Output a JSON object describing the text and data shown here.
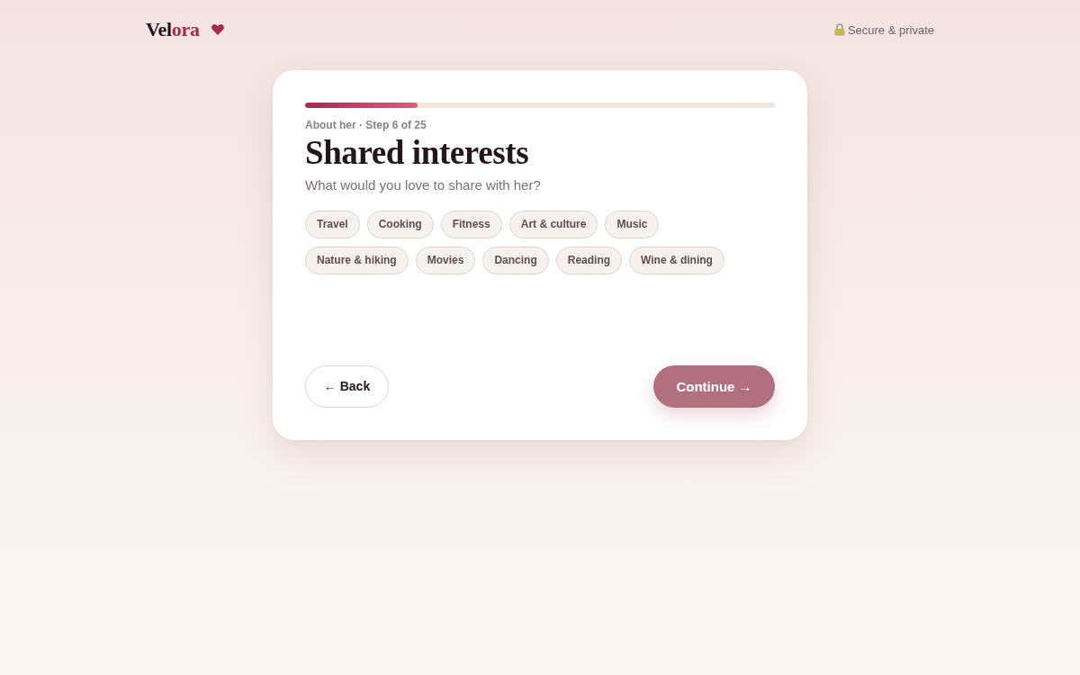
{
  "header": {
    "logo": [
      {
        "text": "Vel",
        "kind": "plain"
      },
      {
        "text": "ora",
        "kind": "accent"
      }
    ],
    "security_note": "Secure & private"
  },
  "card": {
    "progress": {
      "level": 0.24
    },
    "step_label": "About her · Step 6 of 25",
    "title": "Shared interests",
    "subtitle": "What would you love to share with her?",
    "interests": [
      {
        "label": "Travel",
        "selected": false
      },
      {
        "label": "Cooking",
        "selected": false
      },
      {
        "label": "Fitness",
        "selected": false
      },
      {
        "label": "Art & culture",
        "selected": false
      },
      {
        "label": "Music",
        "selected": false
      },
      {
        "label": "Nature & hiking",
        "selected": false
      },
      {
        "label": "Movies",
        "selected": false
      },
      {
        "label": "Dancing",
        "selected": false
      },
      {
        "label": "Reading",
        "selected": false
      },
      {
        "label": "Wine & dining",
        "selected": false
      }
    ],
    "back_button": {
      "label": "← Back"
    },
    "continue_button": {
      "label": "Continue →",
      "disabled": true
    }
  }
}
